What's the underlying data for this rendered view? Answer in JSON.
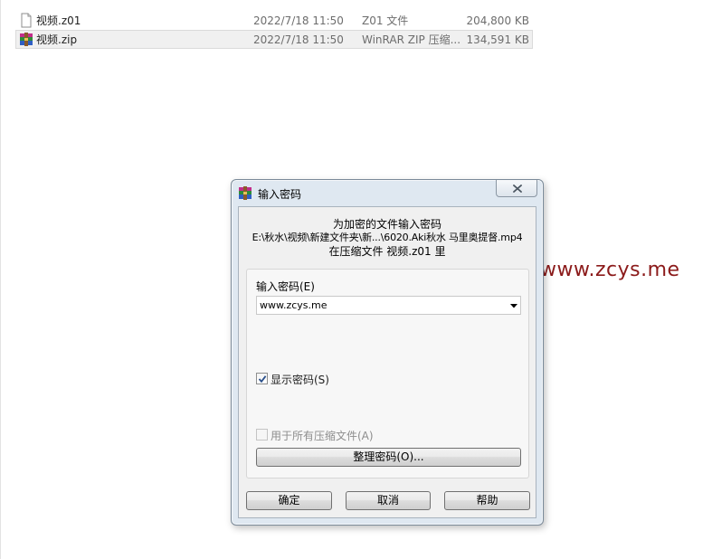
{
  "files": [
    {
      "name": "视频.z01",
      "date": "2022/7/18 11:50",
      "type": "Z01 文件",
      "size": "204,800 KB",
      "icon": "blank-file-icon",
      "selected": false
    },
    {
      "name": "视频.zip",
      "date": "2022/7/18 11:50",
      "type": "WinRAR ZIP 压缩...",
      "size": "134,591 KB",
      "icon": "winrar-zip-icon",
      "selected": true
    }
  ],
  "watermark": "www.zcys.me",
  "dialog": {
    "title": "输入密码",
    "app_icon": "winrar-icon",
    "close_icon": "close-icon",
    "info_line1": "为加密的文件输入密码",
    "info_line2": "E:\\秋水\\视频\\新建文件夹\\新...\\6020.Aki秋水 马里奥提督.mp4",
    "info_line3": "在压缩文件 视频.z01 里",
    "password_label": "输入密码(E)",
    "password_value": "www.zcys.me",
    "show_password_label": "显示密码(S)",
    "show_password_checked": true,
    "use_for_all_label": "用于所有压缩文件(A)",
    "use_for_all_checked": false,
    "use_for_all_enabled": false,
    "organize_button": "整理密码(O)...",
    "ok_button": "确定",
    "cancel_button": "取消",
    "help_button": "帮助"
  },
  "colors": {
    "watermark": "#8b1a1a",
    "dialog_frame": "#dfe8f1",
    "selection": "#f0f0f0"
  }
}
